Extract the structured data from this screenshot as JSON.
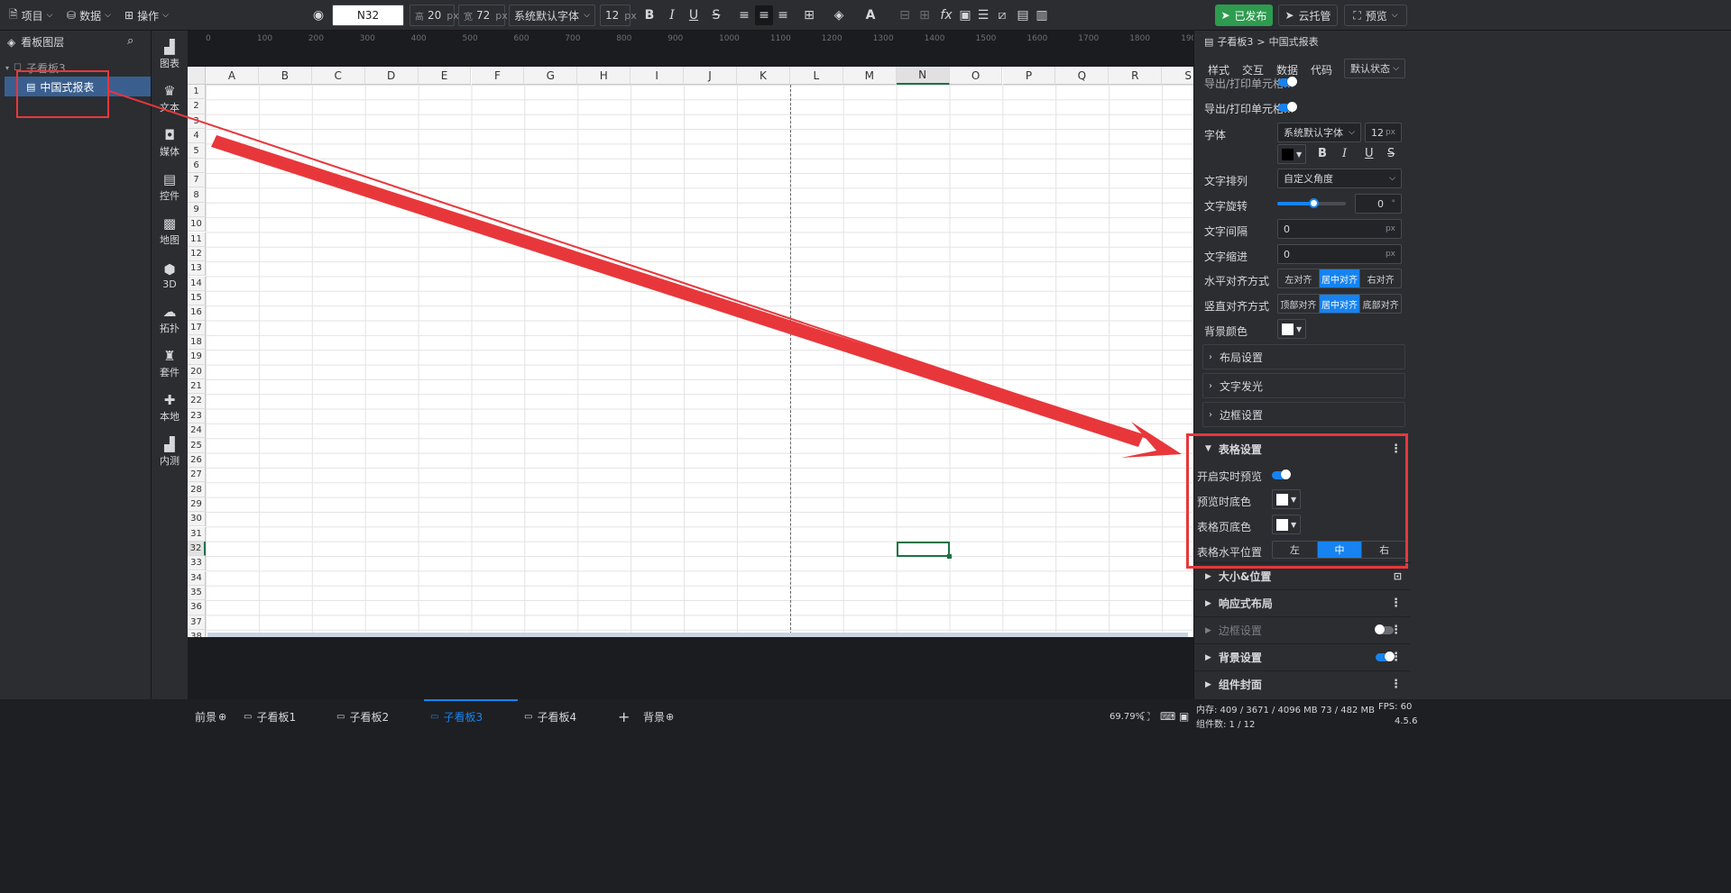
{
  "toolbar": {
    "project_label": "项目",
    "data_label": "数据",
    "operate_label": "操作",
    "cell_ref": "N32",
    "height_label": "高",
    "height_value": "20",
    "width_label": "宽",
    "width_value": "72",
    "unit": "px",
    "font_family": "系统默认字体",
    "font_size": "12",
    "fx_label": "fx",
    "publish_label": "已发布",
    "cloud_label": "云托管",
    "preview_label": "预览"
  },
  "layers": {
    "title": "看板图层",
    "parent": "子看板3",
    "child": "中国式报表"
  },
  "side_icons": [
    "图表",
    "文本",
    "媒体",
    "控件",
    "地图",
    "3D",
    "拓扑",
    "套件",
    "本地",
    "内测"
  ],
  "ruler_top": [
    "0",
    "100",
    "200",
    "300",
    "400",
    "500",
    "600",
    "700",
    "800",
    "900",
    "1000",
    "1100",
    "1200",
    "1300",
    "1400",
    "1500",
    "1600",
    "1700",
    "1800",
    "1900"
  ],
  "ruler_left_mark": "1100",
  "sheet": {
    "columns": [
      "A",
      "B",
      "C",
      "D",
      "E",
      "F",
      "G",
      "H",
      "I",
      "J",
      "K",
      "L",
      "M",
      "N",
      "O",
      "P",
      "Q",
      "R",
      "S"
    ],
    "rows": [
      "1",
      "2",
      "3",
      "4",
      "5",
      "6",
      "7",
      "8",
      "9",
      "10",
      "11",
      "12",
      "13",
      "14",
      "15",
      "16",
      "17",
      "18",
      "19",
      "20",
      "21",
      "22",
      "23",
      "24",
      "25",
      "26",
      "27",
      "28",
      "29",
      "30",
      "31",
      "32",
      "33",
      "34",
      "35",
      "36",
      "37",
      "38"
    ],
    "selected_cell": "N32"
  },
  "right_panel": {
    "breadcrumb_parent": "子看板3",
    "breadcrumb_sep": ">",
    "breadcrumb_current": "中国式报表",
    "tabs": [
      "样式",
      "交互",
      "数据",
      "代码"
    ],
    "state_select": "默认状态",
    "export_print_1": "导出/打印单元格...",
    "export_print_2": "导出/打印单元格...",
    "font_label": "字体",
    "font_value": "系统默认字体",
    "font_size": "12",
    "unit": "px",
    "text_arrange_label": "文字排列",
    "text_arrange_value": "自定义角度",
    "text_rotate_label": "文字旋转",
    "text_rotate_value": "0",
    "degree": "°",
    "letter_spacing_label": "文字间隔",
    "letter_spacing_value": "0",
    "indent_label": "文字缩进",
    "indent_value": "0",
    "h_align_label": "水平对齐方式",
    "h_align_options": [
      "左对齐",
      "居中对齐",
      "右对齐"
    ],
    "v_align_label": "竖直对齐方式",
    "v_align_options": [
      "顶部对齐",
      "居中对齐",
      "底部对齐"
    ],
    "bg_color_label": "背景颜色",
    "layout_settings": "布局设置",
    "text_glow": "文字发光",
    "border_settings": "边框设置",
    "table_settings": "表格设置",
    "realtime_preview_label": "开启实时预览",
    "preview_bg_label": "预览时底色",
    "table_page_bg_label": "表格页底色",
    "table_h_pos_label": "表格水平位置",
    "table_h_pos_options": [
      "左",
      "中",
      "右"
    ],
    "size_position": "大小&位置",
    "responsive_layout": "响应式布局",
    "border_settings_2": "边框设置",
    "background_settings": "背景设置",
    "component_cover": "组件封面"
  },
  "bottom": {
    "front_label": "前景",
    "tabs": [
      "子看板1",
      "子看板2",
      "子看板3",
      "子看板4"
    ],
    "background_label": "背景",
    "zoom": "69.79%",
    "memory": "内存:  409 / 3671 / 4096 MB  73 / 482 MB",
    "components": "组件数: 1 / 12",
    "fps": "FPS:  60",
    "version": "4.5.6"
  },
  "colors": {
    "accent": "#1683f0",
    "publish_green": "#2e9b4f",
    "annotation_red": "#e8373b",
    "selection_green": "#1e7145"
  }
}
